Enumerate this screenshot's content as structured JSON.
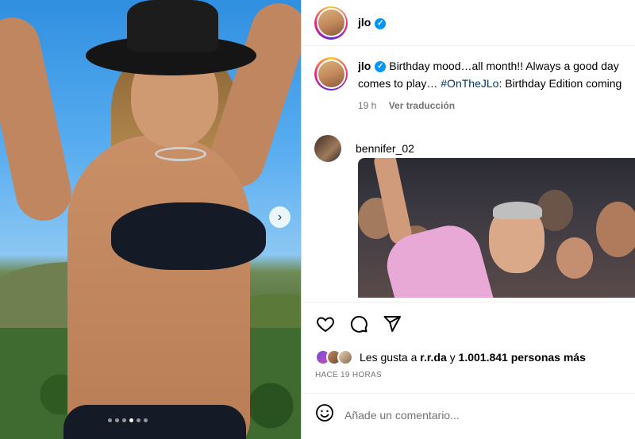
{
  "post": {
    "username": "jlo",
    "caption_text": "Birthday mood…all month!! Always a good day ",
    "caption_line2": "comes to play… ",
    "hashtag": "#OnTheJLo",
    "caption_tail": ": Birthday Edition coming",
    "time_ago": "19 h",
    "translate_label": "Ver traducción"
  },
  "comment": {
    "username": "bennifer_02"
  },
  "likes": {
    "prefix": "Les gusta a ",
    "user": "r.r.da",
    "middle": " y ",
    "count": "1.001.841 personas más"
  },
  "timestamp": "HACE 19 HORAS",
  "composer": {
    "placeholder": "Añade un comentario..."
  },
  "icons": {
    "verified": "verified-badge-icon",
    "like": "heart-icon",
    "comment": "comment-bubble-icon",
    "share": "paper-plane-icon",
    "emoji": "smiley-icon",
    "next": "chevron-right-icon"
  },
  "colors": {
    "verified": "#0095f6",
    "hashtag": "#00376b",
    "muted": "#737373"
  },
  "carousel": {
    "slides": 6,
    "active_slide": 4
  }
}
